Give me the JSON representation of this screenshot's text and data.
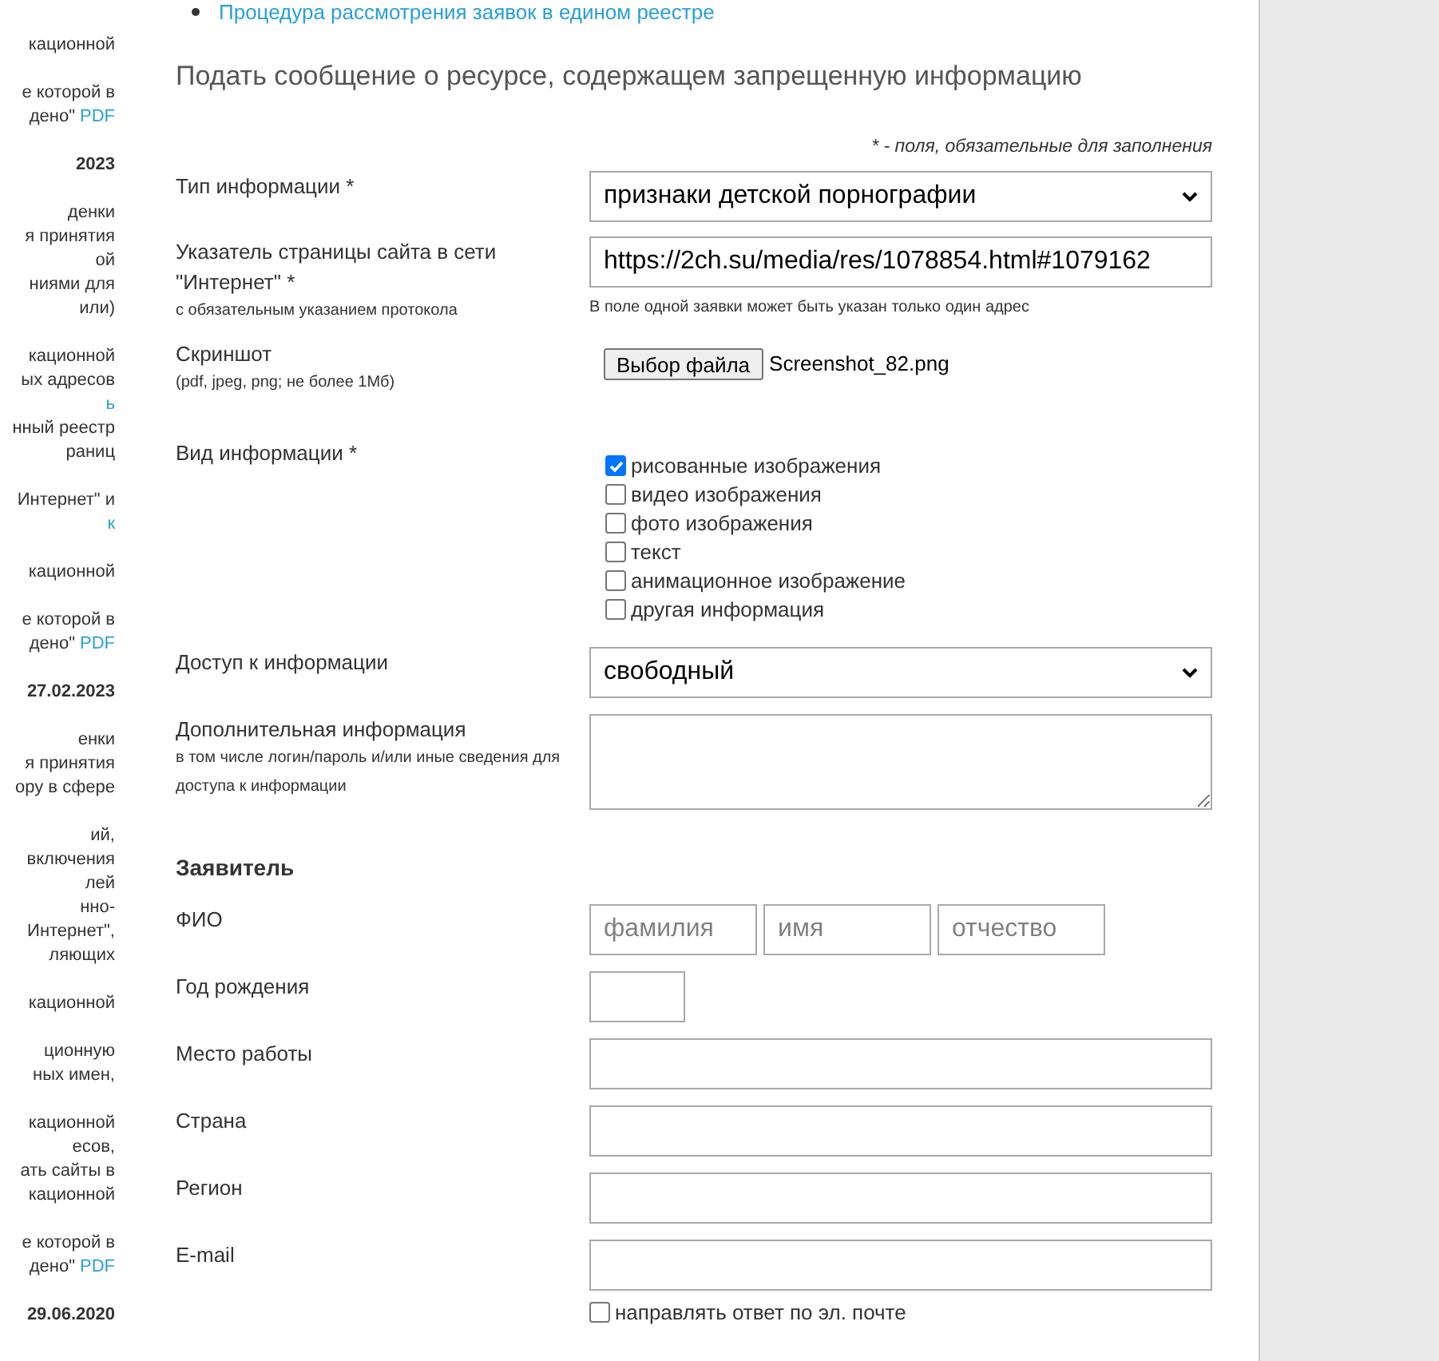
{
  "sidebar": {
    "paragraphs": [
      {
        "kind": "text",
        "lines": [
          "кационной"
        ]
      },
      {
        "kind": "text",
        "lines": [
          "е которой в",
          "дено\""
        ],
        "link": "PDF"
      },
      {
        "kind": "date",
        "lines": [
          "2023"
        ]
      },
      {
        "kind": "text",
        "lines": [
          "денки",
          "я принятия",
          "ой",
          "ниями для",
          "или)"
        ]
      },
      {
        "kind": "text",
        "lines": [
          "кационной",
          "ых адресов",
          "ь",
          "нный реестр",
          "раниц"
        ]
      },
      {
        "kind": "text",
        "lines": [
          "Интернет\" и",
          "к"
        ]
      },
      {
        "kind": "text",
        "lines": [
          "кационной"
        ]
      },
      {
        "kind": "text",
        "lines": [
          "е которой в",
          "дено\""
        ],
        "link": "PDF"
      },
      {
        "kind": "date",
        "lines": [
          "27.02.2023"
        ]
      },
      {
        "kind": "text",
        "lines": [
          "енки",
          "я принятия",
          "ору в сфере"
        ]
      },
      {
        "kind": "text",
        "lines": [
          "ий,",
          "включения",
          "лей",
          "нно-",
          "Интернет\",",
          "ляющих"
        ]
      },
      {
        "kind": "text",
        "lines": [
          "кационной"
        ]
      },
      {
        "kind": "text",
        "lines": [
          "ционную",
          "ных имен,"
        ]
      },
      {
        "kind": "text",
        "lines": [
          "кационной",
          "есов,",
          "ать сайты в",
          "кационной"
        ]
      },
      {
        "kind": "text",
        "lines": [
          "е которой в",
          "дено\""
        ],
        "link": "PDF"
      },
      {
        "kind": "date",
        "lines": [
          "29.06.2020"
        ]
      }
    ]
  },
  "nav_link": "Процедура рассмотрения заявок в едином реестре",
  "form": {
    "title": "Подать сообщение о ресурсе, содержащем запрещенную информацию",
    "required_note": "* - поля, обязательные для заполнения",
    "rows": [
      {
        "kind": "select",
        "label": "Тип информации *",
        "value": "признаки детской порнографии"
      },
      {
        "kind": "url",
        "label": "Указатель страницы сайта в сети \"Интернет\" *",
        "hint": "с обязательным указанием протокола",
        "value": "https://2ch.su/media/res/1078854.html#1079162",
        "note": "В поле одной заявки может быть указан только один адрес"
      },
      {
        "kind": "file",
        "label": "Скриншот",
        "hint": "(pdf, jpeg, png; не более 1Мб)",
        "button": "Выбор файла",
        "filename": "Screenshot_82.png"
      },
      {
        "kind": "checkboxes",
        "label": "Вид информации *",
        "options": [
          {
            "label": "рисованные изображения",
            "checked": true
          },
          {
            "label": "видео изображения",
            "checked": false
          },
          {
            "label": "фото изображения",
            "checked": false
          },
          {
            "label": "текст",
            "checked": false
          },
          {
            "label": "анимационное изображение",
            "checked": false
          },
          {
            "label": "другая информация",
            "checked": false
          }
        ]
      },
      {
        "kind": "select",
        "label": "Доступ к информации",
        "value": "свободный"
      },
      {
        "kind": "textarea",
        "label": "Дополнительная информация",
        "hint": "в том числе логин/пароль и/или иные сведения для доступа к информации"
      },
      {
        "kind": "heading",
        "label": "Заявитель"
      },
      {
        "kind": "name",
        "label": "ФИО",
        "placeholders": [
          "фамилия",
          "имя",
          "отчество"
        ]
      },
      {
        "kind": "short",
        "label": "Год рождения"
      },
      {
        "kind": "text",
        "label": "Место работы"
      },
      {
        "kind": "text",
        "label": "Страна"
      },
      {
        "kind": "text",
        "label": "Регион"
      },
      {
        "kind": "text",
        "label": "E-mail"
      },
      {
        "kind": "checkbox",
        "label": "направлять ответ по эл. почте",
        "checked": false
      }
    ]
  }
}
